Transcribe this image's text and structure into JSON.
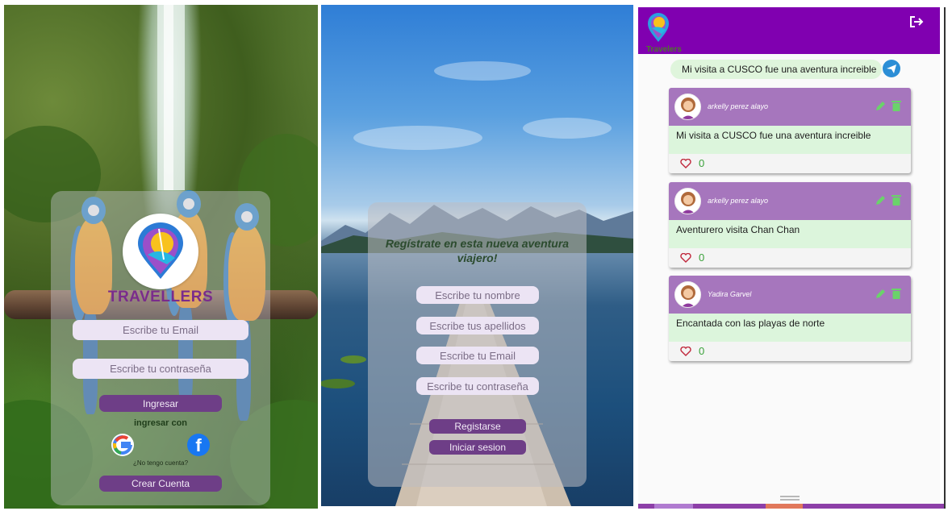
{
  "login": {
    "brand": "TRAVELLERS",
    "email_placeholder": "Escribe tu Email",
    "password_placeholder": "Escribe tu contraseña",
    "login_button": "Ingresar",
    "login_with": "ingresar con",
    "no_account": "¿No tengo cuenta?",
    "create_account_button": "Crear Cuenta",
    "icons": [
      "google-icon",
      "facebook-icon"
    ]
  },
  "register": {
    "title": "Regístrate en esta nueva aventura viajero!",
    "name_placeholder": "Escribe tu nombre",
    "surname_placeholder": "Escribe tus apellidos",
    "email_placeholder": "Escribe tu Email",
    "password_placeholder": "Escribe tu contraseña",
    "register_button": "Registarse",
    "login_button": "Iniciar sesion"
  },
  "feed": {
    "brand": "Travelers",
    "compose_value": "Mi visita a CUSCO fue una aventura increible",
    "header_color": "#8000b0",
    "posts": [
      {
        "author": "arkelly perez alayo",
        "text": "Mi visita a CUSCO fue una aventura increible",
        "likes": "0"
      },
      {
        "author": "arkelly perez alayo",
        "text": "Aventurero visita Chan Chan",
        "likes": "0"
      },
      {
        "author": "Yadira Garvel",
        "text": "Encantada con las playas de norte",
        "likes": "0"
      }
    ]
  }
}
